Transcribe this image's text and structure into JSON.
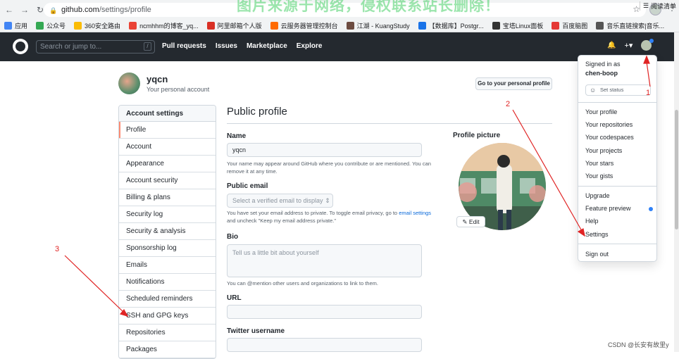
{
  "browser": {
    "url_host": "github.com",
    "url_path": "/settings/profile",
    "watermark": "图片来源于网络，侵权联系站长删除！",
    "bookmarks": [
      "应用",
      "公众号",
      "360安全路由",
      "ncmhhm的博客_yq...",
      "阿里邮箱个人版",
      "云服务器管理控制台",
      "江湖 - KuangStudy",
      "【数据库】Postgr...",
      "宝塔Linux面板",
      "百度脑图",
      "音乐直链搜索|音乐..."
    ],
    "reading_list": "阅读清单",
    "icons": [
      "back-icon",
      "forward-icon",
      "reload-icon",
      "lock-icon",
      "star-icon",
      "menu-icon"
    ]
  },
  "header": {
    "search_placeholder": "Search or jump to...",
    "slash_key": "/",
    "nav": [
      "Pull requests",
      "Issues",
      "Marketplace",
      "Explore"
    ],
    "bell": "🔔",
    "plus": "+▾"
  },
  "user": {
    "name": "yqcn",
    "subtitle": "Your personal account",
    "go_profile": "Go to your personal profile"
  },
  "sidebar": {
    "title": "Account settings",
    "items": [
      "Profile",
      "Account",
      "Appearance",
      "Account security",
      "Billing & plans",
      "Security log",
      "Security & analysis",
      "Sponsorship log",
      "Emails",
      "Notifications",
      "Scheduled reminders",
      "SSH and GPG keys",
      "Repositories",
      "Packages"
    ],
    "active": "Profile"
  },
  "profile_form": {
    "title": "Public profile",
    "name_label": "Name",
    "name_value": "yqcn",
    "name_note": "Your name may appear around GitHub where you contribute or are mentioned. You can remove it at any time.",
    "email_label": "Public email",
    "email_placeholder": "Select a verified email to display ⇕",
    "email_note_1": "You have set your email address to private. To toggle email privacy, go to",
    "email_note_link": "email settings",
    "email_note_2": "and uncheck \"Keep my email address private.\"",
    "bio_label": "Bio",
    "bio_placeholder": "Tell us a little bit about yourself",
    "bio_note": "You can @mention other users and organizations to link to them.",
    "url_label": "URL",
    "twitter_label": "Twitter username",
    "picture_label": "Profile picture",
    "edit_label": "✎ Edit"
  },
  "dropdown": {
    "signed_in": "Signed in as",
    "username": "chen-boop",
    "set_status": "Set status",
    "group1": [
      "Your profile",
      "Your repositories",
      "Your codespaces",
      "Your projects",
      "Your stars",
      "Your gists"
    ],
    "group2": [
      "Upgrade",
      "Feature preview",
      "Help",
      "Settings"
    ],
    "sign_out": "Sign out"
  },
  "annotations": {
    "a1": "1",
    "a2": "2",
    "a3": "3"
  },
  "footer": {
    "csdn": "CSDN @长安有故里y"
  },
  "colors": {
    "accent": "#e02424",
    "header": "#24292f",
    "active_tab": "#fd8c73"
  }
}
